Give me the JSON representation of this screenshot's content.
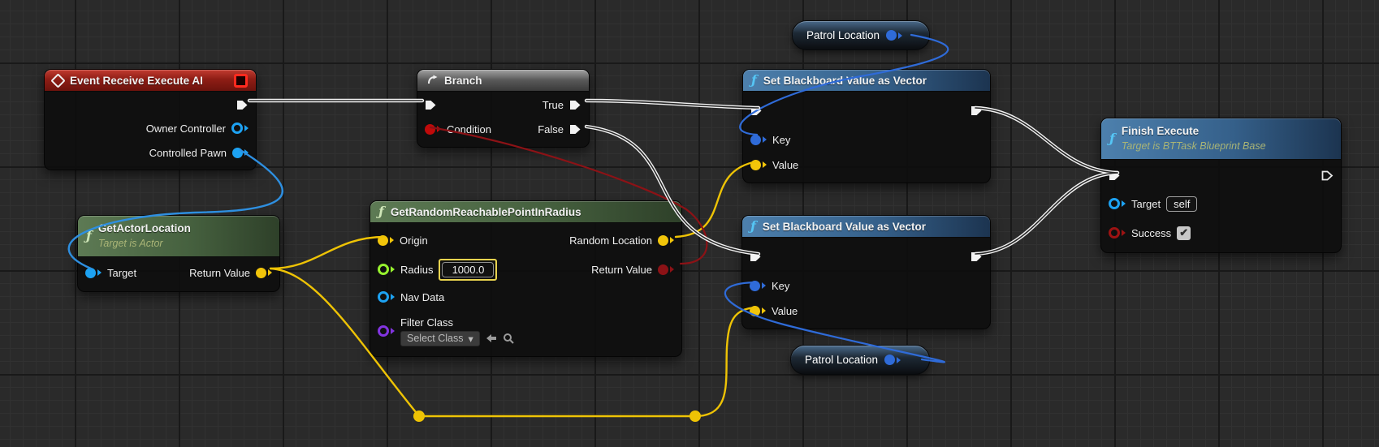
{
  "editor": "unreal-blueprint-graph",
  "icons": {
    "function_glyph": "ƒ",
    "dropdown_caret": "▾",
    "check_glyph": "✔",
    "back_arrow": "⬅",
    "search_glyph": "⌕"
  },
  "colors": {
    "canvas_bg": "#2a2a2a",
    "grid_minor": "#313131",
    "grid_major": "#191919",
    "exec_wire": "#f2f2f2",
    "object_blue": "#1da2f2",
    "key_blue": "#2f6bd8",
    "vector_yellow": "#f2c50a",
    "float_green": "#96f12e",
    "bool_red_bright": "#c00a0a",
    "bool_red_dark": "#8c1216",
    "class_purple": "#8234e0",
    "header_event_red": "#8e1d15",
    "header_function_green": "#46613f",
    "header_function_blue": "#35608a",
    "header_branch_gray": "#585858"
  },
  "nodes": {
    "event_receive_execute_ai": {
      "title": "Event Receive Execute AI",
      "pin_owner_controller": "Owner Controller",
      "pin_controlled_pawn": "Controlled Pawn"
    },
    "branch": {
      "title": "Branch",
      "pin_condition": "Condition",
      "pin_true": "True",
      "pin_false": "False"
    },
    "get_actor_location": {
      "title": "GetActorLocation",
      "subtitle": "Target is Actor",
      "pin_target": "Target",
      "pin_return_value": "Return Value"
    },
    "get_random_reachable_point_in_radius": {
      "title": "GetRandomReachablePointInRadius",
      "pin_origin": "Origin",
      "pin_radius": "Radius",
      "radius_value": "1000.0",
      "pin_nav_data": "Nav Data",
      "pin_filter_class": "Filter Class",
      "select_class_label": "Select Class",
      "pin_random_location": "Random Location",
      "pin_return_value": "Return Value"
    },
    "set_blackboard_value_as_vector_1": {
      "title": "Set Blackboard Value as Vector",
      "pin_key": "Key",
      "pin_value": "Value"
    },
    "set_blackboard_value_as_vector_2": {
      "title": "Set Blackboard Value as Vector",
      "pin_key": "Key",
      "pin_value": "Value"
    },
    "finish_execute": {
      "title": "Finish Execute",
      "subtitle": "Target is BTTask Blueprint Base",
      "pin_target": "Target",
      "target_value": "self",
      "pin_success": "Success",
      "success_checked": true
    },
    "patrol_location_top": {
      "label": "Patrol Location"
    },
    "patrol_location_bottom": {
      "label": "Patrol Location"
    }
  }
}
